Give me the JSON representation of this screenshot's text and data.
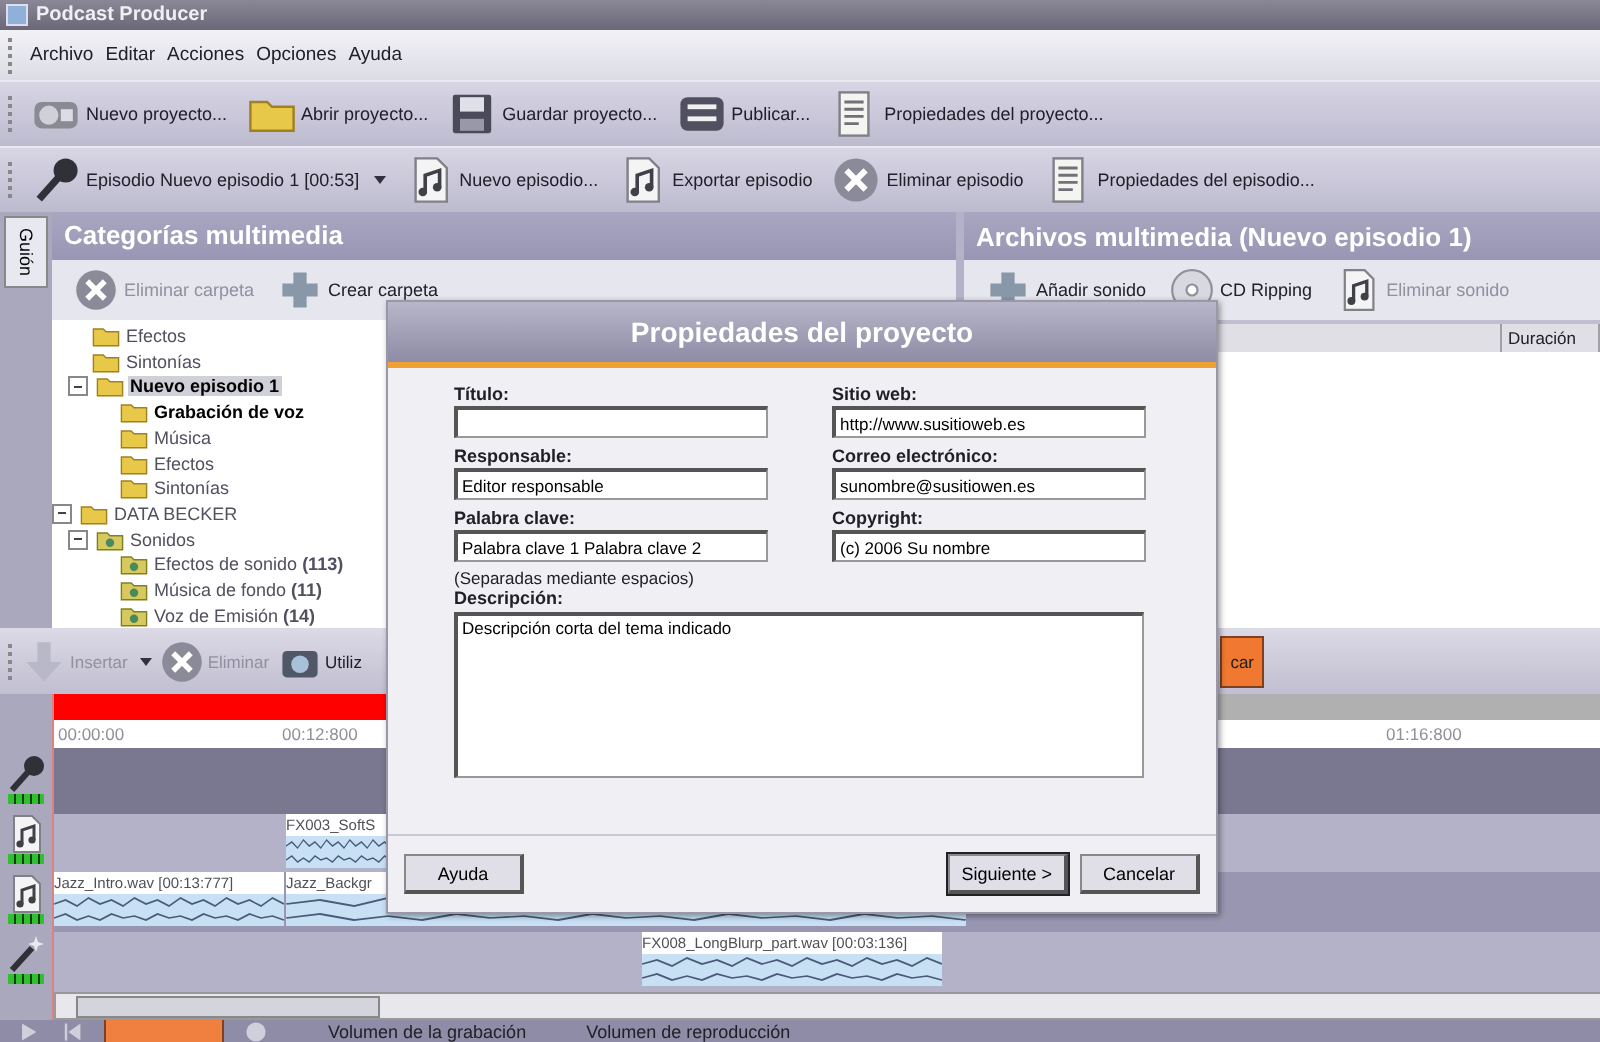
{
  "window": {
    "title": "Podcast Producer"
  },
  "menu": [
    "Archivo",
    "Editar",
    "Acciones",
    "Opciones",
    "Ayuda"
  ],
  "project_toolbar": [
    {
      "kind": "radio",
      "label": "Nuevo proyecto..."
    },
    {
      "kind": "folder",
      "label": "Abrir proyecto..."
    },
    {
      "kind": "floppy",
      "label": "Guardar proyecto..."
    },
    {
      "kind": "onair",
      "label": "Publicar..."
    },
    {
      "kind": "document",
      "label": "Propiedades del proyecto..."
    }
  ],
  "episode_toolbar": {
    "selector": "Episodio Nuevo episodio 1 [00:53]",
    "buttons": [
      {
        "kind": "note",
        "label": "Nuevo episodio..."
      },
      {
        "kind": "export",
        "label": "Exportar episodio"
      },
      {
        "kind": "delete",
        "label": "Eliminar episodio"
      },
      {
        "kind": "document",
        "label": "Propiedades del episodio..."
      }
    ]
  },
  "side_tab": {
    "label": "Guión",
    "selected": true
  },
  "media_categories": {
    "title": "Categorías multimedia",
    "toolbar": [
      {
        "kind": "delete",
        "label": "Eliminar carpeta",
        "disabled": true
      },
      {
        "kind": "add",
        "label": "Crear carpeta",
        "disabled": false
      }
    ],
    "tree": [
      {
        "children": [
          {
            "label": "Efectos",
            "kind": "folder",
            "selected": false,
            "bold": false
          },
          {
            "label": "Sintonías",
            "kind": "folder",
            "selected": false,
            "bold": false
          },
          {
            "label": "Nuevo episodio 1",
            "kind": "episode",
            "selected": true,
            "bold": true,
            "expanded": true,
            "children": [
              {
                "label": "Grabación de voz",
                "kind": "folder",
                "selected": false,
                "bold": true
              },
              {
                "label": "Música",
                "kind": "folder",
                "selected": false,
                "bold": false
              },
              {
                "label": "Efectos",
                "kind": "folder",
                "selected": false,
                "bold": false
              },
              {
                "label": "Sintonías",
                "kind": "folder",
                "selected": false,
                "bold": false
              }
            ]
          }
        ]
      },
      {
        "label": "DATA BECKER",
        "kind": "folder",
        "selected": false,
        "bold": false,
        "expanded": true,
        "children": [
          {
            "label": "Sonidos",
            "kind": "library",
            "selected": false,
            "bold": false,
            "expanded": true,
            "children": [
              {
                "label": "Efectos de sonido **(113)**",
                "kind": "library",
                "selected": false,
                "bold": false
              },
              {
                "label": "Música de fondo **(11)**",
                "kind": "library",
                "selected": false,
                "bold": false
              },
              {
                "label": "Voz de Emisión **(14)**",
                "kind": "library",
                "selected": false,
                "bold": false
              }
            ]
          }
        ]
      }
    ]
  },
  "media_files": {
    "title": "Archivos multimedia (Nuevo episodio 1)",
    "toolbar": [
      {
        "kind": "add",
        "label": "Añadir sonido",
        "disabled": false
      },
      {
        "kind": "cd",
        "label": "CD Ripping",
        "disabled": false
      },
      {
        "kind": "note",
        "label": "Eliminar sonido",
        "disabled": true
      }
    ],
    "columns": [
      "Duración"
    ]
  },
  "timeline_toolbar": [
    {
      "kind": "insert",
      "label": "Insertar",
      "disabled": true,
      "dropdown": true
    },
    {
      "kind": "delete",
      "label": "Eliminar",
      "disabled": true,
      "dropdown": false
    },
    {
      "kind": "camera",
      "label": "Utiliz",
      "disabled": false,
      "dropdown": false
    },
    {
      "kind": "orange",
      "label": "car",
      "disabled": false,
      "dropdown": false
    }
  ],
  "ruler": [
    "00:00:00",
    "00:12:800",
    "01:16:800"
  ],
  "tracks": [
    {
      "kind": "voice"
    },
    {
      "kind": "music",
      "clips": [
        {
          "label": "FX003_SoftS"
        }
      ]
    },
    {
      "kind": "music",
      "clips": [
        {
          "label": "Jazz_Intro.wav [00:13:777]"
        },
        {
          "label": "Jazz_Backgr"
        }
      ]
    },
    {
      "kind": "effects",
      "clips": [
        {
          "label": "FX008_LongBlurp_part.wav [00:03:136]"
        }
      ]
    }
  ],
  "status_bar": [
    "Volumen de la grabación",
    "Volumen de reproducción"
  ],
  "dialog": {
    "title": "Propiedades del proyecto",
    "fields": [
      {
        "label": "Título:"
      },
      {
        "label": "Sitio web:",
        "value": "http://www.susitioweb.es"
      },
      {
        "label": "Responsable:",
        "value": "Editor responsable"
      },
      {
        "label": "Correo electrónico:",
        "value": "sunombre@susitiowen.es"
      },
      {
        "label": "Palabra clave:",
        "value": "Palabra clave 1 Palabra clave 2",
        "note": "(Separadas mediante espacios)"
      },
      {
        "label": "Copyright:",
        "value": "(c) 2006 Su nombre"
      }
    ],
    "description": {
      "label": "Descripción:",
      "value": "Descripción corta del tema indicado"
    },
    "buttons": [
      {
        "label": "Ayuda",
        "default": false
      },
      {
        "label": "Siguiente >",
        "default": true
      },
      {
        "label": "Cancelar",
        "default": false
      }
    ]
  }
}
